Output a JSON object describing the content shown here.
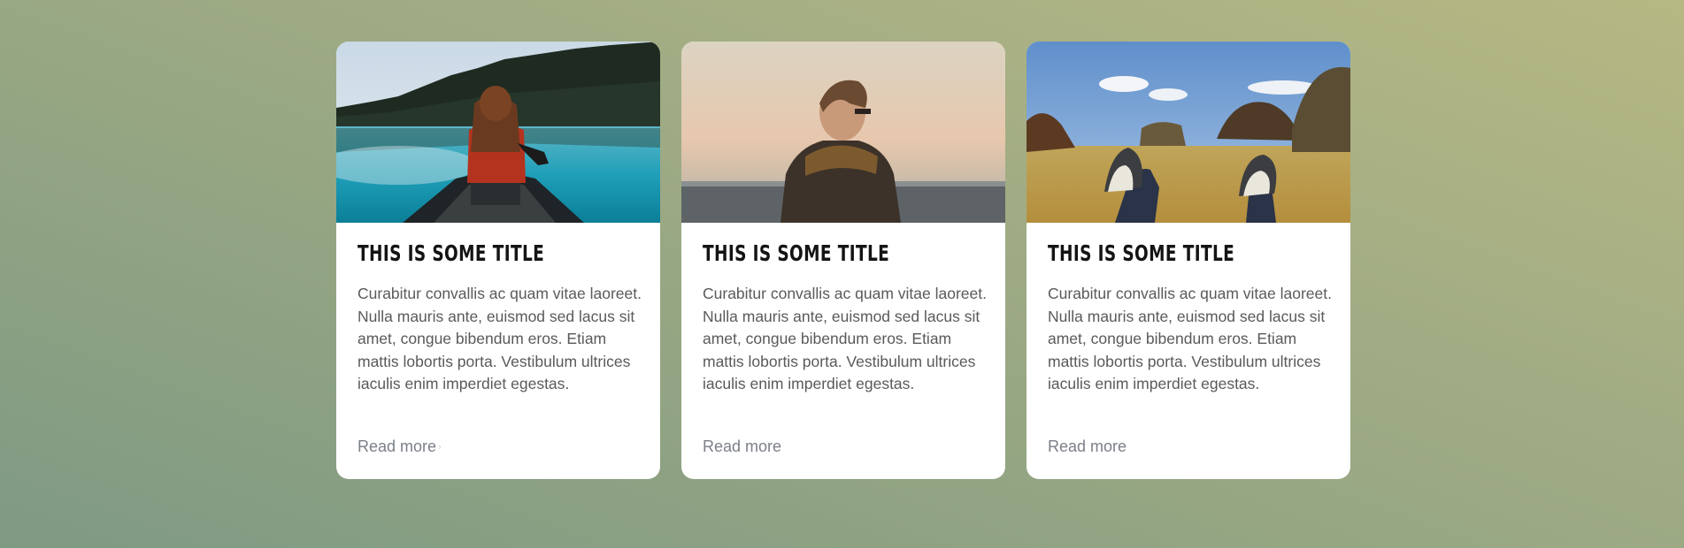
{
  "cards": [
    {
      "image": "woman in canoe on lake",
      "title": "This is some title",
      "text": "Curabitur convallis ac quam vitae laoreet. Nulla mauris ante, euismod sed lacus sit amet, congue bibendum eros. Etiam mattis lobortis porta. Vestibulum ultrices iaculis enim imperdiet egestas.",
      "link": "Read more"
    },
    {
      "image": "man looking at sea at sunset",
      "title": "This is some title",
      "text": "Curabitur convallis ac quam vitae laoreet. Nulla mauris ante, euismod sed lacus sit amet, congue bibendum eros. Etiam mattis lobortis porta. Vestibulum ultrices iaculis enim imperdiet egestas.",
      "link": "Read more"
    },
    {
      "image": "sneakers on grass field",
      "title": "This is some title",
      "text": "Curabitur convallis ac quam vitae laoreet. Nulla mauris ante, euismod sed lacus sit amet, congue bibendum eros. Etiam mattis lobortis porta. Vestibulum ultrices iaculis enim imperdiet egestas.",
      "link": "Read more"
    }
  ],
  "colors": {
    "background_start": "#b6b883",
    "background_end": "#7f9a83",
    "card": "#ffffff",
    "title": "#141414",
    "text": "#5a5a5a",
    "link": "#7b7f87"
  }
}
